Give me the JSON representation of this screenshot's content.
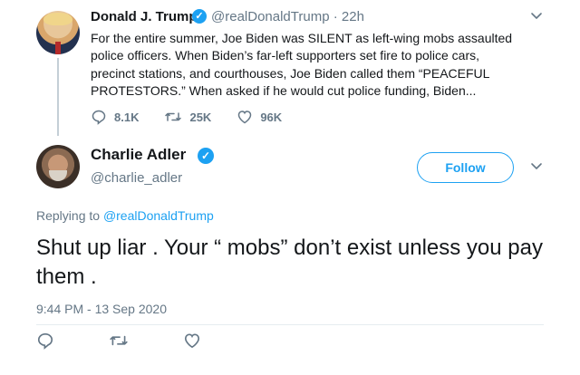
{
  "parent_tweet": {
    "author_name": "Donald J. Trump",
    "handle": "@realDonaldTrump",
    "separator": " · ",
    "age": "22h",
    "body": "For the entire summer, Joe Biden was SILENT as left-wing mobs assaulted police officers. When Biden’s far-left supporters set fire to police cars, precinct stations, and courthouses, Joe Biden called them “PEACEFUL PROTESTORS.” When asked if he would cut police funding, Biden...",
    "replies": "8.1K",
    "retweets": "25K",
    "likes": "96K",
    "verified_mark": "✓"
  },
  "reply_tweet": {
    "author_name": "Charlie Adler",
    "handle": "@charlie_adler",
    "follow_label": "Follow",
    "replying_prefix": "Replying to ",
    "replying_to": "@realDonaldTrump",
    "body": "Shut up liar . Your “ mobs” don’t exist unless you pay them .",
    "timestamp": "9:44 PM - 13 Sep 2020",
    "verified_mark": "✓"
  },
  "colors": {
    "accent": "#1da1f2",
    "muted": "#657786",
    "text": "#14171a"
  },
  "icons": [
    "chevron-down-icon",
    "reply-icon",
    "retweet-icon",
    "like-icon",
    "verified-icon"
  ]
}
